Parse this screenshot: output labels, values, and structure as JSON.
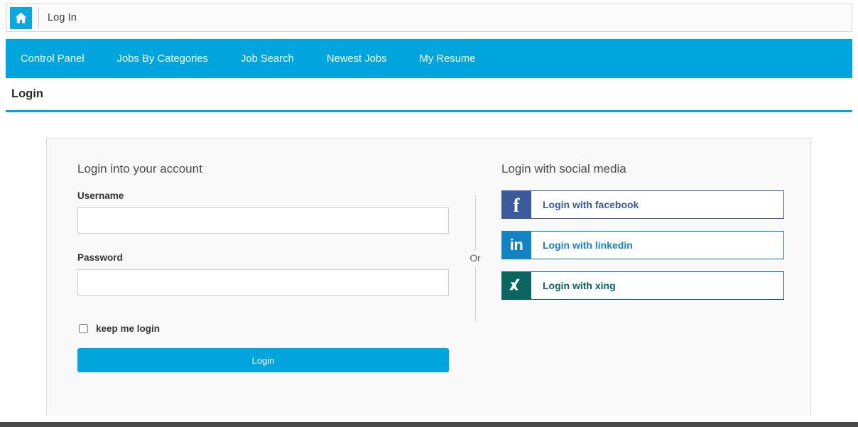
{
  "titlebar": {
    "home_icon": "home-icon",
    "title": "Log In"
  },
  "nav": {
    "items": [
      {
        "label": "Control Panel"
      },
      {
        "label": "Jobs By Categories"
      },
      {
        "label": "Job Search"
      },
      {
        "label": "Newest Jobs"
      },
      {
        "label": "My Resume"
      }
    ]
  },
  "page": {
    "heading": "Login"
  },
  "form": {
    "section_title": "Login into your account",
    "username": {
      "label": "Username",
      "value": "",
      "placeholder": ""
    },
    "password": {
      "label": "Password",
      "value": "",
      "placeholder": ""
    },
    "keep_login": {
      "label": "keep me login",
      "checked": false
    },
    "submit_label": "Login"
  },
  "divider": {
    "text": "Or"
  },
  "social": {
    "section_title": "Login with social media",
    "buttons": [
      {
        "label": "Login with facebook",
        "icon": "facebook-icon",
        "glyph": "f",
        "color": "#3b5a9b"
      },
      {
        "label": "Login with linkedin",
        "icon": "linkedin-icon",
        "glyph": "in",
        "color": "#1383c1"
      },
      {
        "label": "Login with xing",
        "icon": "xing-icon",
        "glyph": "X",
        "color": "#0a6560"
      }
    ]
  },
  "colors": {
    "accent": "#00a5dd",
    "panel_bg": "#f9f9f9",
    "facebook": "#3b5a9b",
    "linkedin": "#1383c1",
    "xing": "#0a6560"
  }
}
